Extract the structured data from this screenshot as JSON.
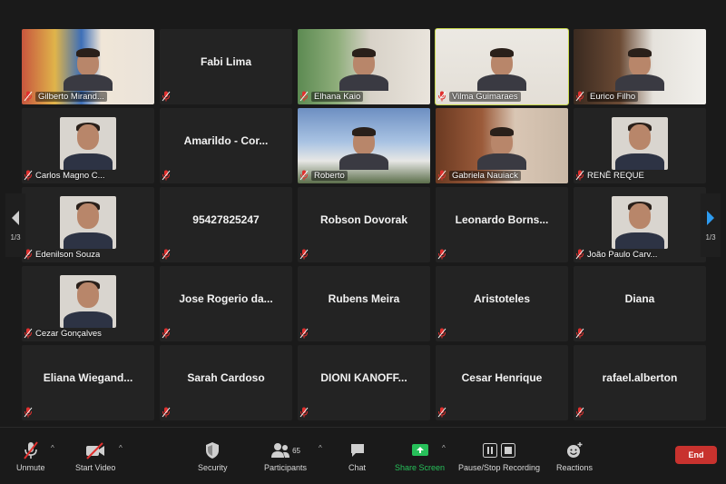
{
  "participants": [
    {
      "name": "Gilberto Mirand...",
      "type": "photo",
      "scene": "scene-gilberto"
    },
    {
      "name": "Fabi Lima",
      "type": "name"
    },
    {
      "name": "Elhana Kaio",
      "type": "photo",
      "scene": "scene-elhana"
    },
    {
      "name": "Vilma Guimaraes",
      "type": "photo",
      "scene": "scene-vilma",
      "active": true
    },
    {
      "name": "Eurico Filho",
      "type": "photo",
      "scene": "scene-eurico"
    },
    {
      "name": "Carlos Magno C...",
      "type": "portrait"
    },
    {
      "name": "Amarildo  - Cor...",
      "type": "name"
    },
    {
      "name": "Roberto",
      "type": "photo",
      "scene": "scene-roberto"
    },
    {
      "name": "Gabriela Nauiack",
      "type": "photo",
      "scene": "scene-gabriela"
    },
    {
      "name": "RENÊ REQUE",
      "type": "portrait"
    },
    {
      "name": "Edenilson Souza",
      "type": "portrait"
    },
    {
      "name": "95427825247",
      "type": "name"
    },
    {
      "name": "Robson Dovorak",
      "type": "name"
    },
    {
      "name": "Leonardo  Borns...",
      "type": "name"
    },
    {
      "name": "João Paulo Carv...",
      "type": "portrait"
    },
    {
      "name": "Cezar Gonçalves",
      "type": "portrait"
    },
    {
      "name": "Jose  Rogerio da...",
      "type": "name"
    },
    {
      "name": "Rubens Meira",
      "type": "name"
    },
    {
      "name": "Aristoteles",
      "type": "name"
    },
    {
      "name": "Diana",
      "type": "name"
    },
    {
      "name": "Eliana  Wiegand...",
      "type": "name"
    },
    {
      "name": "Sarah Cardoso",
      "type": "name"
    },
    {
      "name": "DIONI  KANOFF...",
      "type": "name"
    },
    {
      "name": "Cesar Henrique",
      "type": "name"
    },
    {
      "name": "rafael.alberton",
      "type": "name"
    }
  ],
  "pagination": {
    "left": "1/3",
    "right": "1/3"
  },
  "toolbar": {
    "unmute": "Unmute",
    "start_video": "Start Video",
    "security": "Security",
    "participants": "Participants",
    "participants_count": "65",
    "chat": "Chat",
    "share_screen": "Share Screen",
    "recording": "Pause/Stop Recording",
    "reactions": "Reactions",
    "end": "End"
  },
  "colors": {
    "active_speaker": "#c8d84c",
    "share_green": "#27c05a",
    "end_red": "#c8322e",
    "mute_red": "#e0302e"
  }
}
